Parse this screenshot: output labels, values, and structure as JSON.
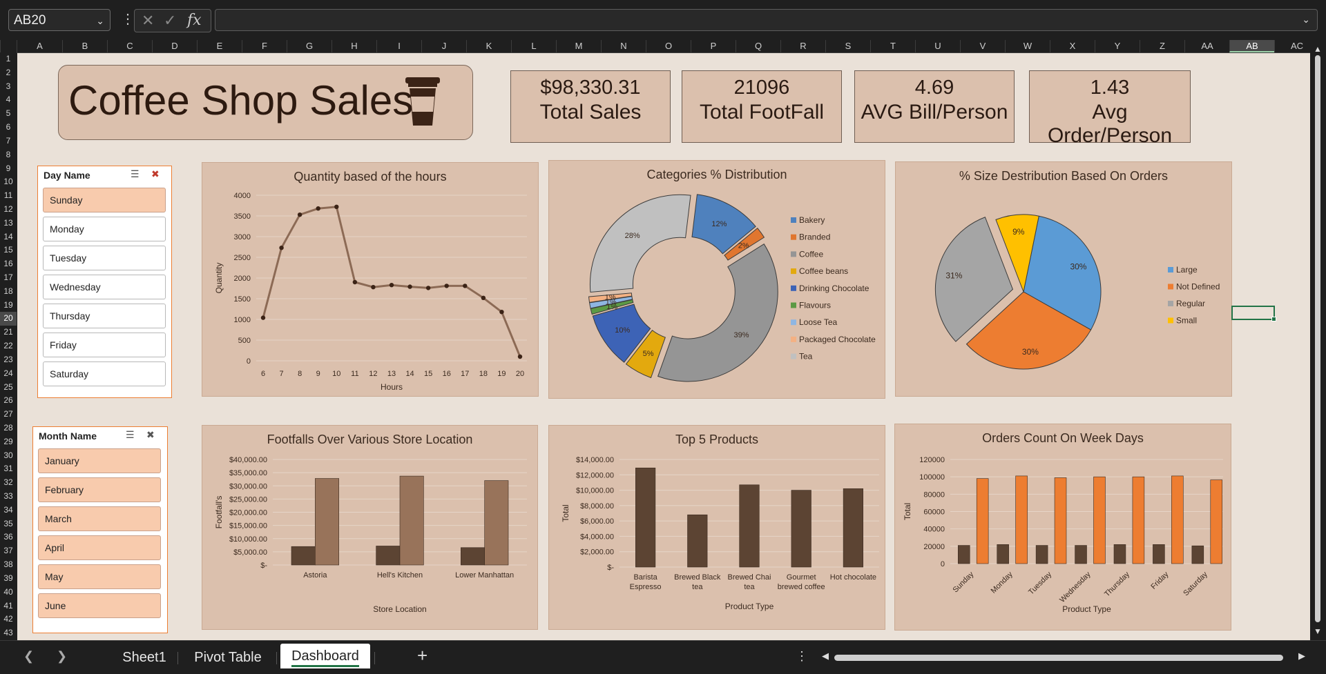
{
  "formula_bar": {
    "name_box": "AB20",
    "formula": "",
    "fx": "fx"
  },
  "columns": [
    "A",
    "B",
    "C",
    "D",
    "E",
    "F",
    "G",
    "H",
    "I",
    "J",
    "K",
    "L",
    "M",
    "N",
    "O",
    "P",
    "Q",
    "R",
    "S",
    "T",
    "U",
    "V",
    "W",
    "X",
    "Y",
    "Z",
    "AA",
    "AB",
    "AC"
  ],
  "selected_column": "AB",
  "rows": [
    "1",
    "2",
    "3",
    "4",
    "5",
    "6",
    "7",
    "8",
    "9",
    "10",
    "11",
    "12",
    "13",
    "14",
    "15",
    "16",
    "17",
    "18",
    "19",
    "20",
    "21",
    "22",
    "23",
    "24",
    "25",
    "26",
    "27",
    "28",
    "29",
    "30",
    "31",
    "32",
    "33",
    "34",
    "35",
    "36",
    "37",
    "38",
    "39",
    "40",
    "41",
    "42",
    "43"
  ],
  "selected_row": "20",
  "dashboard": {
    "title": "Coffee Shop Sales",
    "kpis": [
      {
        "value": "$98,330.31",
        "label": "Total Sales"
      },
      {
        "value": "21096",
        "label": "Total FootFall"
      },
      {
        "value": "4.69",
        "label": "AVG Bill/Person"
      },
      {
        "value": "1.43",
        "label": "Avg Order/Person"
      }
    ]
  },
  "slicers": {
    "day": {
      "title": "Day Name",
      "items": [
        {
          "label": "Sunday",
          "selected": true
        },
        {
          "label": "Monday",
          "selected": false
        },
        {
          "label": "Tuesday",
          "selected": false
        },
        {
          "label": "Wednesday",
          "selected": false
        },
        {
          "label": "Thursday",
          "selected": false
        },
        {
          "label": "Friday",
          "selected": false
        },
        {
          "label": "Saturday",
          "selected": false
        }
      ]
    },
    "month": {
      "title": "Month Name",
      "items": [
        {
          "label": "January",
          "selected": true
        },
        {
          "label": "February",
          "selected": true
        },
        {
          "label": "March",
          "selected": true
        },
        {
          "label": "April",
          "selected": true
        },
        {
          "label": "May",
          "selected": true
        },
        {
          "label": "June",
          "selected": true
        }
      ]
    }
  },
  "chart_data": [
    {
      "type": "line",
      "title": "Quantity based of the hours",
      "xlabel": "Hours",
      "ylabel": "Quantity",
      "ylim": [
        0,
        4000
      ],
      "yticks": [
        "0",
        "500",
        "1000",
        "1500",
        "2000",
        "2500",
        "3000",
        "3500",
        "4000"
      ],
      "x": [
        "6",
        "7",
        "8",
        "9",
        "10",
        "11",
        "12",
        "13",
        "14",
        "15",
        "16",
        "17",
        "18",
        "19",
        "20"
      ],
      "values": [
        1040,
        2730,
        3530,
        3680,
        3720,
        1900,
        1780,
        1830,
        1790,
        1760,
        1810,
        1810,
        1520,
        1180,
        100
      ],
      "color": "#8c6a55"
    },
    {
      "type": "pie",
      "title": "Categories % Distribution",
      "donut": true,
      "slices": [
        {
          "label": "Bakery",
          "value": 12,
          "text": "12%",
          "color": "#4f81bd"
        },
        {
          "label": "Branded",
          "value": 2,
          "text": "2%",
          "color": "#e0762f"
        },
        {
          "label": "Coffee",
          "value": 39,
          "text": "39%",
          "color": "#959595"
        },
        {
          "label": "Coffee beans",
          "value": 5,
          "text": "5%",
          "color": "#e3a90e"
        },
        {
          "label": "Drinking Chocolate",
          "value": 10,
          "text": "10%",
          "color": "#3d63b6"
        },
        {
          "label": "Flavours",
          "value": 1,
          "text": "1%",
          "color": "#5c9a45"
        },
        {
          "label": "Loose Tea",
          "value": 1,
          "text": "1%",
          "color": "#8fb6e2"
        },
        {
          "label": "Packaged Chocolate",
          "value": 1,
          "text": "1%",
          "color": "#f4b183"
        },
        {
          "label": "Tea",
          "value": 28,
          "text": "28%",
          "color": "#c0c0c0"
        }
      ]
    },
    {
      "type": "pie",
      "title": "% Size Destribution Based On Orders",
      "slices": [
        {
          "label": "Large",
          "value": 30,
          "text": "30%",
          "color": "#5b9bd5"
        },
        {
          "label": "Not Defined",
          "value": 30,
          "text": "30%",
          "color": "#ed7d31"
        },
        {
          "label": "Regular",
          "value": 31,
          "text": "31%",
          "color": "#a5a5a5"
        },
        {
          "label": "Small",
          "value": 9,
          "text": "9%",
          "color": "#ffc000"
        }
      ]
    },
    {
      "type": "bar",
      "title": "Footfalls Over Various Store Location",
      "xlabel": "Store Location",
      "ylabel": "Footfall's",
      "ylim": [
        0,
        40000
      ],
      "yticks": [
        "$-",
        "$5,000.00",
        "$10,000.00",
        "$15,000.00",
        "$20,000.00",
        "$25,000.00",
        "$30,000.00",
        "$35,000.00",
        "$40,000.00"
      ],
      "categories": [
        "Astoria",
        "Hell's Kitchen",
        "Lower Manhattan"
      ],
      "series": [
        {
          "values": [
            7000,
            7200,
            6600
          ],
          "color": "#5c4433"
        },
        {
          "values": [
            32800,
            33700,
            32000
          ],
          "color": "#98735a"
        }
      ]
    },
    {
      "type": "bar",
      "title": "Top 5 Products",
      "xlabel": "Product Type",
      "ylabel": "Total",
      "ylim": [
        0,
        14000
      ],
      "yticks": [
        "$-",
        "$2,000.00",
        "$4,000.00",
        "$6,000.00",
        "$8,000.00",
        "$10,000.00",
        "$12,000.00",
        "$14,000.00"
      ],
      "categories": [
        "Barista Espresso",
        "Brewed Black tea",
        "Brewed Chai tea",
        "Gourmet brewed coffee",
        "Hot chocolate"
      ],
      "series": [
        {
          "values": [
            12900,
            6800,
            10700,
            10000,
            10200
          ],
          "color": "#5c4433"
        }
      ]
    },
    {
      "type": "bar",
      "title": "Orders Count On Week Days",
      "xlabel": "Product Type",
      "ylabel": "Total",
      "ylim": [
        0,
        120000
      ],
      "yticks": [
        "0",
        "20000",
        "40000",
        "60000",
        "80000",
        "100000",
        "120000"
      ],
      "categories": [
        "Sunday",
        "Monday",
        "Tuesday",
        "Wednesday",
        "Thursday",
        "Friday",
        "Saturday"
      ],
      "series": [
        {
          "values": [
            21000,
            22000,
            21000,
            21000,
            22000,
            22000,
            20500
          ],
          "color": "#5c4433"
        },
        {
          "values": [
            98000,
            101000,
            99000,
            100000,
            100000,
            101000,
            96500
          ],
          "color": "#ed7d31"
        }
      ]
    }
  ],
  "sheet_tabs": [
    {
      "label": "Sheet1",
      "active": false
    },
    {
      "label": "Pivot Table",
      "active": false
    },
    {
      "label": "Dashboard",
      "active": true
    }
  ],
  "add_sheet": "+"
}
